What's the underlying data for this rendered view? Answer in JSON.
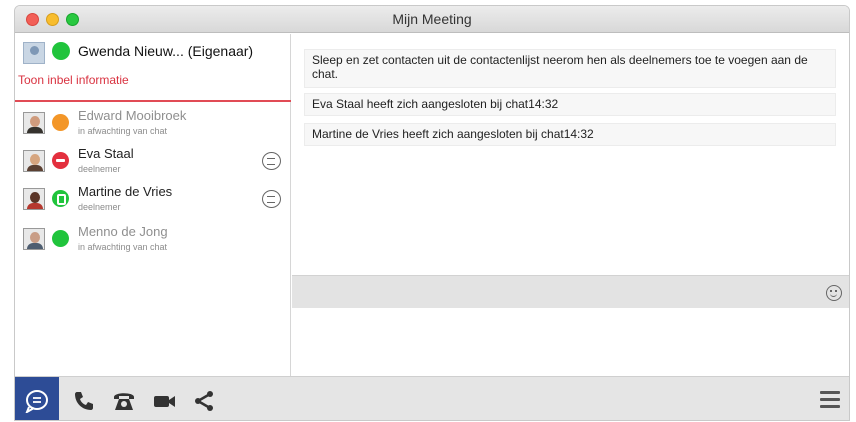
{
  "window": {
    "title": "Mijn Meeting"
  },
  "owner": {
    "name": "Gwenda Nieuw... (Eigenaar)",
    "dial_link": "Toon inbel informatie"
  },
  "contacts": [
    {
      "name": "Edward Mooibroek",
      "status": "in afwachting van chat",
      "indicator": "orange"
    },
    {
      "name": "Eva Staal",
      "status": "deelnemer",
      "indicator": "red"
    },
    {
      "name": "Martine de Vries",
      "status": "deelnemer",
      "indicator": "call"
    },
    {
      "name": "Menno de Jong",
      "status": "in afwachting van chat",
      "indicator": "green"
    }
  ],
  "chat": {
    "messages": [
      "Sleep en zet contacten uit de contactenlijst neerom hen als deelnemers toe te voegen aan de chat.",
      "Eva Staal heeft zich aangesloten bij chat14:32",
      "Martine de Vries heeft zich aangesloten bij chat14:32"
    ]
  },
  "toolbar": {
    "icons": [
      "chat-icon",
      "phone-icon",
      "desk-phone-icon",
      "video-icon",
      "share-icon",
      "menu-icon"
    ]
  },
  "colors": {
    "accent": "#2d4c96",
    "status_green": "#20c43c",
    "status_orange": "#f39628",
    "status_red": "#e3303e",
    "dial_link": "#d93240"
  }
}
